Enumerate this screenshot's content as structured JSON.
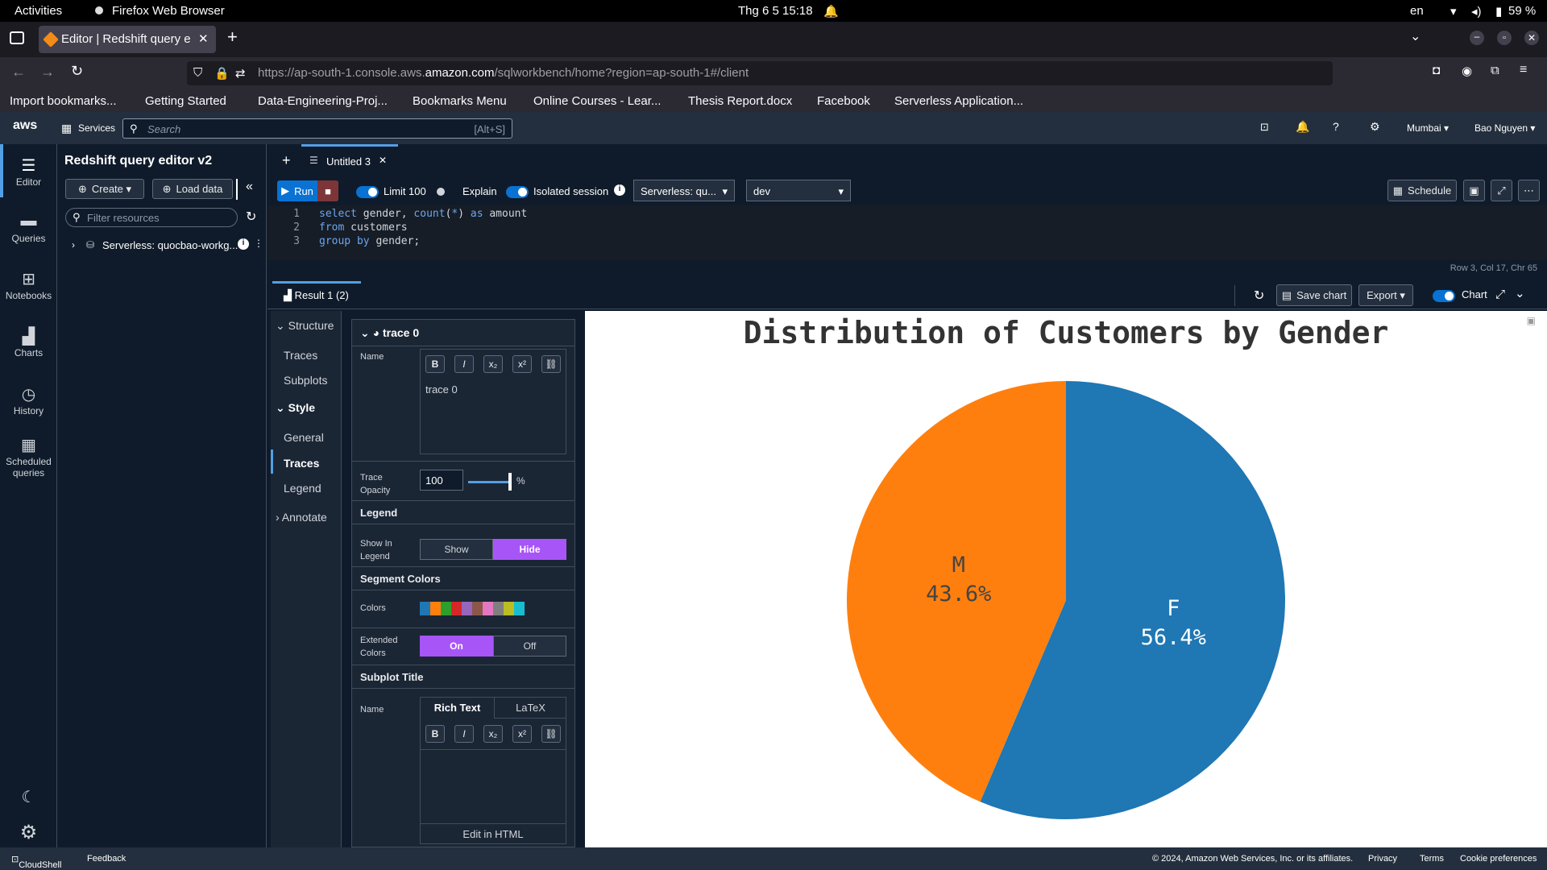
{
  "system": {
    "activities": "Activities",
    "app": "Firefox Web Browser",
    "datetime": "Thg 6 5  15:18",
    "lang": "en",
    "battery": "59 %"
  },
  "browser": {
    "tab_title": "Editor | Redshift query e",
    "url_prefix": "https://ap-south-1.console.aws.",
    "url_domain": "amazon.com",
    "url_suffix": "/sqlworkbench/home?region=ap-south-1#/client",
    "bookmarks": [
      "Import bookmarks...",
      "Getting Started",
      "Data-Engineering-Proj...",
      "Bookmarks Menu",
      "Online Courses - Lear...",
      "Thesis Report.docx",
      "Facebook",
      "Serverless Application..."
    ]
  },
  "aws": {
    "logo": "aws",
    "services": "Services",
    "search_placeholder": "Search",
    "search_shortcut": "[Alt+S]",
    "region": "Mumbai ▾",
    "user": "Bao Nguyen ▾"
  },
  "rail": {
    "editor": "Editor",
    "queries": "Queries",
    "notebooks": "Notebooks",
    "charts": "Charts",
    "history": "History",
    "scheduled1": "Scheduled",
    "scheduled2": "queries"
  },
  "panel": {
    "title": "Redshift query editor v2",
    "create": "Create ▾",
    "load": "Load data",
    "filter_placeholder": "Filter resources",
    "tree_item": "Serverless: quocbao-workg..."
  },
  "editor": {
    "new_tab": "+",
    "tab": "Untitled 3",
    "run": "Run",
    "limit": "Limit 100",
    "explain": "Explain",
    "isolated": "Isolated session",
    "workgroup": "Serverless: qu...",
    "database": "dev",
    "schedule": "Schedule",
    "lines": [
      "1",
      "2",
      "3"
    ],
    "status": "Row 3,  Col 17,  Chr 65"
  },
  "results": {
    "tab": "Result 1",
    "count": "(2)",
    "save_chart": "Save chart",
    "export": "Export ▾",
    "chart": "Chart"
  },
  "structure": {
    "structure": "Structure",
    "traces1": "Traces",
    "subplots": "Subplots",
    "style": "Style",
    "general": "General",
    "traces2": "Traces",
    "legend": "Legend",
    "annotate": "Annotate"
  },
  "trace_panel": {
    "header": "trace 0",
    "name_label": "Name",
    "name_value": "trace 0",
    "opacity_label1": "Trace",
    "opacity_label2": "Opacity",
    "opacity_value": "100",
    "opacity_unit": "%",
    "opacity_level": 1.0,
    "legend_title": "Legend",
    "show_label1": "Show In",
    "show_label2": "Legend",
    "show": "Show",
    "hide": "Hide",
    "segment_title": "Segment Colors",
    "colors_label": "Colors",
    "swatches": [
      "#1f77b4",
      "#ff7f0e",
      "#2ca02c",
      "#d62728",
      "#9467bd",
      "#8c564b",
      "#e377c2",
      "#7f7f7f",
      "#bcbd22",
      "#17becf"
    ],
    "ext_label1": "Extended",
    "ext_label2": "Colors",
    "on": "On",
    "off": "Off",
    "subplot_title": "Subplot Title",
    "name2_label": "Name",
    "rich_text": "Rich Text",
    "latex": "LaTeX",
    "edit_html": "Edit in HTML",
    "bold": "B",
    "italic": "I",
    "sub": "x₂",
    "sup": "x²"
  },
  "chart_data": {
    "type": "pie",
    "title": "Distribution of Customers by Gender",
    "labels": [
      "F",
      "M"
    ],
    "values": [
      56.4,
      43.6
    ],
    "display": [
      "56.4%",
      "43.6%"
    ],
    "colors": [
      "#1f77b4",
      "#ff7f0e"
    ]
  },
  "footer": {
    "cloudshell": "CloudShell",
    "feedback": "Feedback",
    "copyright": "© 2024, Amazon Web Services, Inc. or its affiliates.",
    "privacy": "Privacy",
    "terms": "Terms",
    "cookies": "Cookie preferences"
  }
}
